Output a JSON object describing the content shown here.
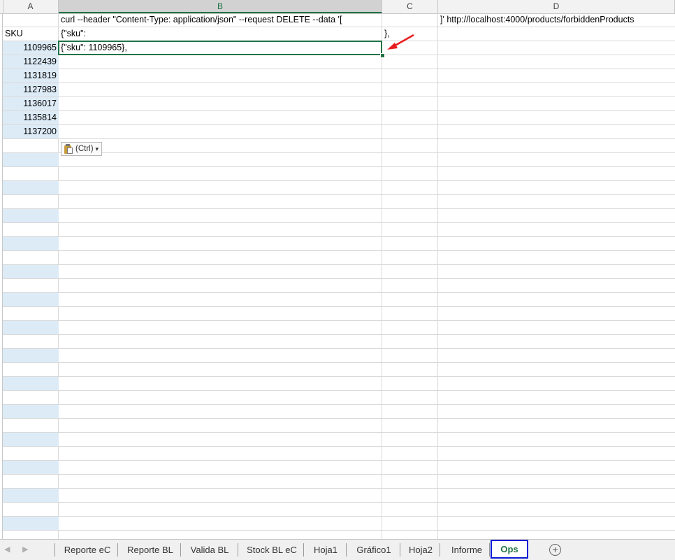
{
  "columns": [
    "A",
    "B",
    "C",
    "D"
  ],
  "rows": [
    {
      "a": "",
      "b": "curl --header \"Content-Type: application/json\" --request DELETE --data '[",
      "c": "",
      "d": "]' http://localhost:4000/products/forbiddenProducts"
    },
    {
      "a": "SKU",
      "b": "{\"sku\":",
      "c": "},",
      "d": ""
    },
    {
      "a": "1109965",
      "b": "{\"sku\": 1109965},",
      "c": "",
      "d": ""
    },
    {
      "a": "1122439",
      "b": "",
      "c": "",
      "d": ""
    },
    {
      "a": "1131819",
      "b": "",
      "c": "",
      "d": ""
    },
    {
      "a": "1127983",
      "b": "",
      "c": "",
      "d": ""
    },
    {
      "a": "1136017",
      "b": "",
      "c": "",
      "d": ""
    },
    {
      "a": "1135814",
      "b": "",
      "c": "",
      "d": ""
    },
    {
      "a": "1137200",
      "b": "",
      "c": "",
      "d": ""
    }
  ],
  "paste_options": {
    "label": "(Ctrl)",
    "dropdown": "▾",
    "icon": "clipboard-paste-icon"
  },
  "sheet_tabs": {
    "prev": "◀",
    "next": "▶",
    "tabs": [
      "Reporte eC",
      "Reporte BL",
      "Valida BL",
      "Stock BL eC",
      "Hoja1",
      "Gráfico1",
      "Hoja2",
      "Informe",
      "Ops"
    ],
    "active": "Ops",
    "add": "+"
  },
  "colors": {
    "selection_fill": "#ddebf7",
    "active_border": "#217346",
    "annotation_arrow": "#e81e1e",
    "active_tab_outline": "#0a1bd6"
  }
}
